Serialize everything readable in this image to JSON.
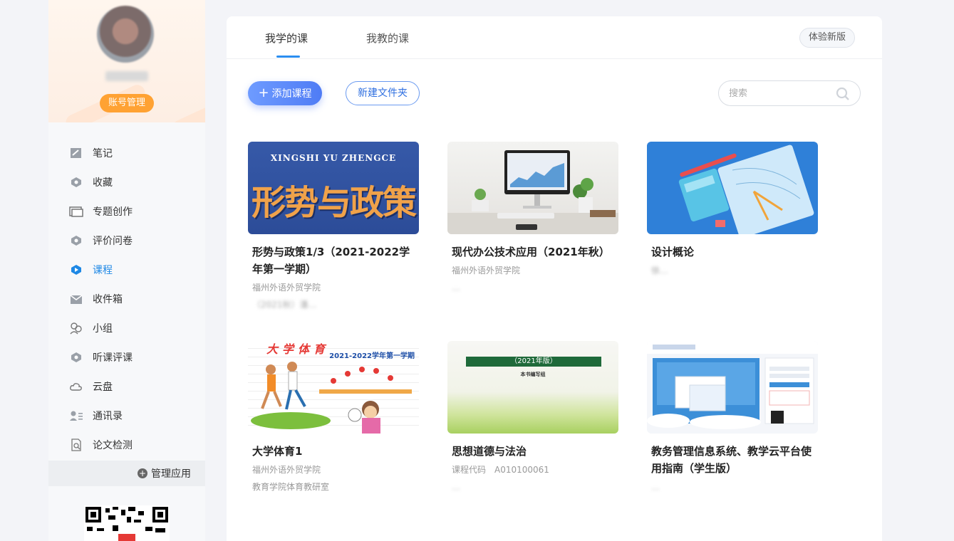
{
  "profile": {
    "account_button": "账号管理"
  },
  "menu": [
    {
      "label": "笔记",
      "icon": "note-icon"
    },
    {
      "label": "收藏",
      "icon": "favorite-icon"
    },
    {
      "label": "专题创作",
      "icon": "topic-icon"
    },
    {
      "label": "评价问卷",
      "icon": "survey-icon"
    },
    {
      "label": "课程",
      "icon": "course-icon",
      "active": true
    },
    {
      "label": "收件箱",
      "icon": "inbox-icon"
    },
    {
      "label": "小组",
      "icon": "group-icon"
    },
    {
      "label": "听课评课",
      "icon": "review-icon"
    },
    {
      "label": "云盘",
      "icon": "cloud-icon"
    },
    {
      "label": "通讯录",
      "icon": "contacts-icon"
    },
    {
      "label": "论文检测",
      "icon": "paper-check-icon"
    }
  ],
  "manage_apps": "管理应用",
  "tabs": {
    "learn": "我学的课",
    "teach": "我教的课"
  },
  "new_version": "体验新版",
  "actions": {
    "add_course": "添加课程",
    "new_folder": "新建文件夹"
  },
  "search": {
    "placeholder": "搜索"
  },
  "accent_color": "#2b8ef0",
  "courses": [
    {
      "title": "形势与政策1/3（2021-2022学年第一学期）",
      "school": "福州外语外贸学院",
      "teacher": "（2021秋）潘…",
      "thumb_text_top": "XINGSHI YU ZHENGCE",
      "thumb_text_main": "形势与政策"
    },
    {
      "title": "现代办公技术应用（2021年秋）",
      "school": "福州外语外贸学院",
      "teacher": "…"
    },
    {
      "title": "设计概论",
      "school": "",
      "teacher": "徐…"
    },
    {
      "title": "大学体育1",
      "school": "福州外语外贸学院",
      "teacher": "教育学院体育教研室",
      "thumb_text_top": "大学体育",
      "thumb_text_sub": "2021-2022学年第一学期"
    },
    {
      "title": "思想道德与法治",
      "school": "课程代码　A010100061",
      "teacher": "…",
      "thumb_text_top": "（2021年版）",
      "thumb_text_sub": "本书编写组"
    },
    {
      "title": "教务管理信息系统、教学云平台使用指南（学生版）",
      "school": "",
      "teacher": "…"
    }
  ]
}
